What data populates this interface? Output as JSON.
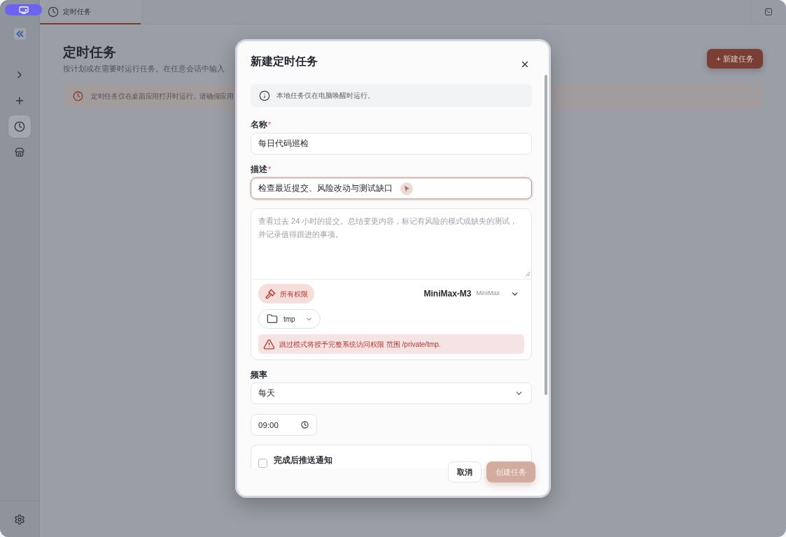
{
  "sidebar": {
    "items": [
      {
        "kind": "expand",
        "selected": false
      },
      {
        "kind": "new",
        "selected": false
      },
      {
        "kind": "schedules",
        "selected": true
      },
      {
        "kind": "store",
        "selected": false
      }
    ]
  },
  "tabs": [
    {
      "label": "定时任务",
      "selected": true
    }
  ],
  "page": {
    "title": "定时任务",
    "subtitle": "按计划或在需要时运行任务。在任意会话中输入",
    "new_button": "+ 新建任务",
    "notice": "定时任务仅在桌面应用打开时运行。请确保应用"
  },
  "dialog": {
    "title": "新建定时任务",
    "info": "本地任务仅在电脑唤醒时运行。",
    "fields": [
      {
        "label": "名称",
        "required_mark": "*",
        "value": "每日代码巡检",
        "focused": false
      },
      {
        "label": "描述",
        "required_mark": "*",
        "value": "检查最近提交、风险改动与测试缺口",
        "focused": true
      }
    ],
    "prompt": {
      "placeholder": "查看过去 24 小时的提交。总结变更内容，标记有风险的模式或缺失的测试，并记录值得跟进的事项。",
      "permission": "所有权限",
      "model": "MiniMax-M3",
      "provider": "MiniMax",
      "folder": "tmp",
      "warning": "跳过模式将授予完整系统访问权限 范围 /private/tmp."
    },
    "frequency": {
      "label": "频率",
      "value": "每天"
    },
    "time": {
      "value": "09:00"
    },
    "notify": {
      "label": "完成后推送通知",
      "checked": false
    },
    "buttons": [
      {
        "label": "取消",
        "kind": "secondary",
        "disabled": false
      },
      {
        "label": "创建任务",
        "kind": "primary",
        "disabled": true
      }
    ]
  }
}
